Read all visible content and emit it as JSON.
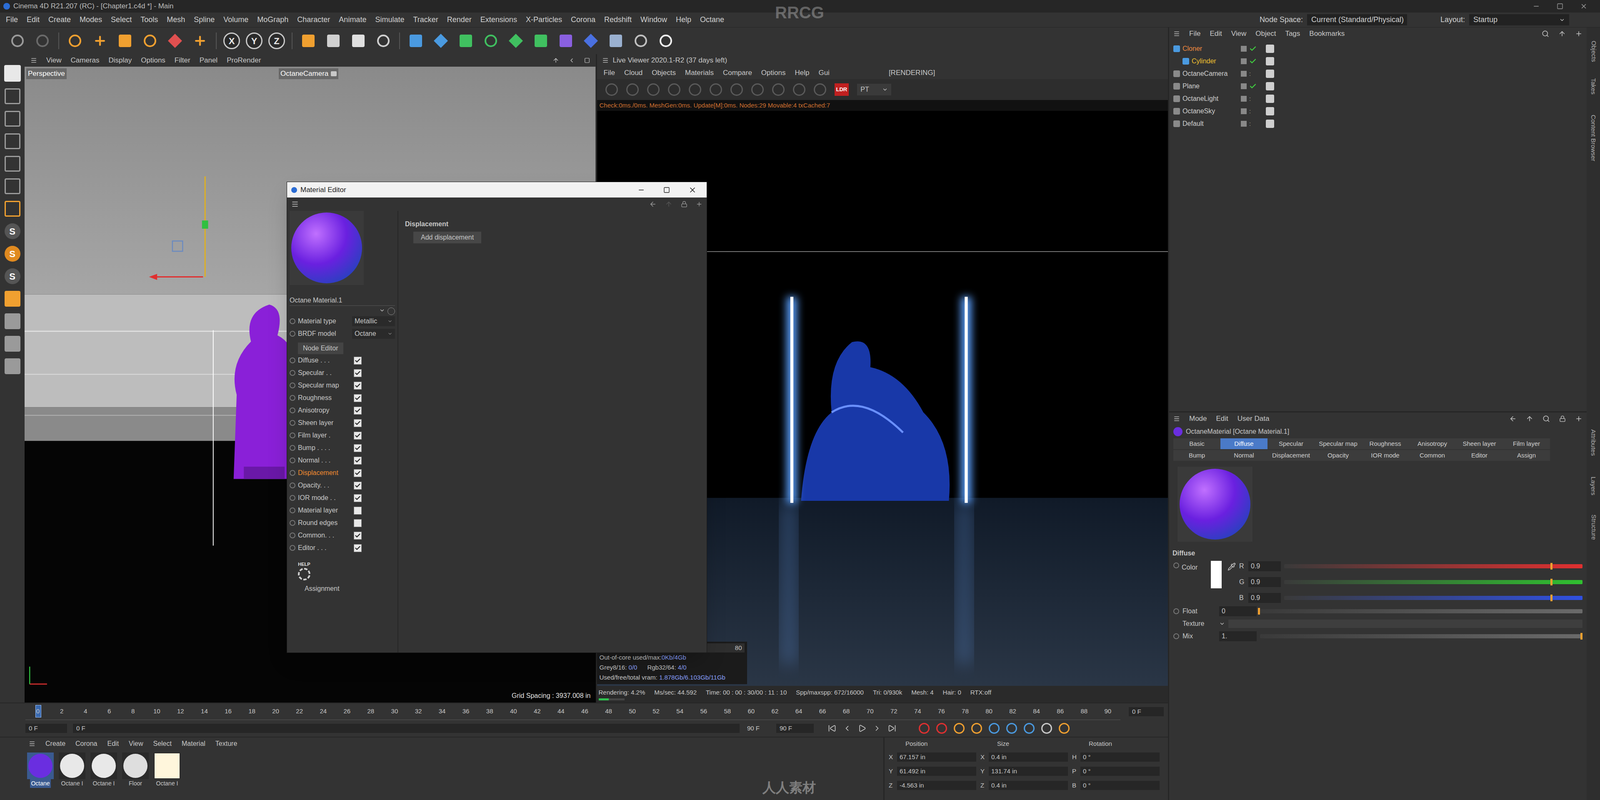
{
  "window": {
    "title": "Cinema 4D R21.207 (RC) - [Chapter1.c4d *] - Main"
  },
  "menu": [
    "File",
    "Edit",
    "Create",
    "Modes",
    "Select",
    "Tools",
    "Mesh",
    "Spline",
    "Volume",
    "MoGraph",
    "Character",
    "Animate",
    "Simulate",
    "Tracker",
    "Render",
    "Extensions",
    "X-Particles",
    "Corona",
    "Redshift",
    "Window",
    "Help",
    "Octane"
  ],
  "node_space": {
    "label": "Node Space:",
    "value": "Current (Standard/Physical)"
  },
  "layout": {
    "label": "Layout:",
    "value": "Startup"
  },
  "toolbar": {
    "axes": [
      "X",
      "Y",
      "Z"
    ]
  },
  "left_tools": {
    "snap_letters": [
      "S",
      "S",
      "S"
    ]
  },
  "viewport": {
    "menu": [
      "View",
      "Cameras",
      "Display",
      "Options",
      "Filter",
      "Panel",
      "ProRender"
    ],
    "name": "Perspective",
    "camera": "OctaneCamera",
    "grid_spacing": "Grid Spacing : 3937.008 in"
  },
  "live_viewer": {
    "title": "Live Viewer 2020.1-R2 (37 days left)",
    "menu": [
      "File",
      "Cloud",
      "Objects",
      "Materials",
      "Compare",
      "Options",
      "Help",
      "Gui"
    ],
    "status": "[RENDERING]",
    "badge": "LDR",
    "mode": "PT",
    "info": "Check:0ms./0ms. MeshGen:0ms. Update[M]:0ms. Nodes:29 Movable:4 txCached:7",
    "field": "80",
    "stats": [
      [
        {
          "label": "Out-of-core used/max:",
          "value": "0Kb/4Gb"
        }
      ],
      [
        {
          "label": "Grey8/16: ",
          "value": "0/0"
        },
        {
          "label": "Rgb32/64: ",
          "value": "4/0"
        }
      ],
      [
        {
          "label": "Used/free/total vram: ",
          "value": "1.878Gb/6.103Gb/11Gb"
        }
      ]
    ],
    "status_bar": [
      "Rendering: 4.2%",
      "Ms/sec: 44.592",
      "Time: 00 : 00 : 30/00 : 11 : 10",
      "Spp/maxspp: 672/16000",
      "Tri: 0/930k",
      "Mesh: 4",
      "Hair: 0",
      "RTX:off"
    ],
    "progress": {
      "level": 0.042
    }
  },
  "material_editor": {
    "title": "Material Editor",
    "material_name": "Octane Material.1",
    "fields": [
      {
        "label": "Material type",
        "value": "Metallic"
      },
      {
        "label": "BRDF model",
        "value": "Octane"
      }
    ],
    "node_button": "Node Editor",
    "channels": [
      {
        "label": "Diffuse . . .",
        "checked": true,
        "selected": false
      },
      {
        "label": "Specular . .",
        "checked": true,
        "selected": false
      },
      {
        "label": "Specular map",
        "checked": true,
        "selected": false
      },
      {
        "label": "Roughness",
        "checked": true,
        "selected": false
      },
      {
        "label": "Anisotropy",
        "checked": true,
        "selected": false
      },
      {
        "label": "Sheen layer",
        "checked": true,
        "selected": false
      },
      {
        "label": "Film layer .",
        "checked": true,
        "selected": false
      },
      {
        "label": "Bump . . . .",
        "checked": true,
        "selected": false
      },
      {
        "label": "Normal . . .",
        "checked": true,
        "selected": false
      },
      {
        "label": "Displacement",
        "checked": true,
        "selected": true
      },
      {
        "label": "Opacity. . .",
        "checked": true,
        "selected": false
      },
      {
        "label": "IOR mode . .",
        "checked": true,
        "selected": false
      },
      {
        "label": "Material layer",
        "checked": false,
        "selected": false
      },
      {
        "label": "Round edges",
        "checked": false,
        "selected": false
      },
      {
        "label": "Common. . .",
        "checked": true,
        "selected": false
      },
      {
        "label": "Editor . . .",
        "checked": true,
        "selected": false
      }
    ],
    "help": "HELP",
    "assignment": "Assignment",
    "section": "Displacement",
    "add_button": "Add displacement"
  },
  "object_manager": {
    "menu": [
      "File",
      "Edit",
      "View",
      "Object",
      "Tags",
      "Bookmarks"
    ],
    "objects": [
      {
        "name": "Cloner",
        "depth": 0,
        "selected": true,
        "enabled": true
      },
      {
        "name": "Cylinder",
        "depth": 1,
        "selected": true,
        "enabled": true
      },
      {
        "name": "OctaneCamera",
        "depth": 0,
        "selected": false,
        "enabled": false
      },
      {
        "name": "Plane",
        "depth": 0,
        "selected": false,
        "enabled": true
      },
      {
        "name": "OctaneLight",
        "depth": 0,
        "selected": false,
        "enabled": false
      },
      {
        "name": "OctaneSky",
        "depth": 0,
        "selected": false,
        "enabled": false
      },
      {
        "name": "Default",
        "depth": 0,
        "selected": false,
        "enabled": false
      }
    ]
  },
  "attributes": {
    "menu": [
      "Mode",
      "Edit",
      "User Data"
    ],
    "title": "OctaneMaterial [Octane Material.1]",
    "tabs": [
      [
        {
          "label": "Basic",
          "selected": false
        },
        {
          "label": "Diffuse",
          "selected": true
        },
        {
          "label": "Specular",
          "selected": false
        },
        {
          "label": "Specular map",
          "selected": false
        },
        {
          "label": "Roughness",
          "selected": false
        },
        {
          "label": "Anisotropy",
          "selected": false
        },
        {
          "label": "Sheen layer",
          "selected": false
        },
        {
          "label": "Film layer",
          "selected": false
        }
      ],
      [
        {
          "label": "Bump",
          "selected": false
        },
        {
          "label": "Normal",
          "selected": false
        },
        {
          "label": "Displacement",
          "selected": false
        },
        {
          "label": "Opacity",
          "selected": false
        },
        {
          "label": "IOR mode",
          "selected": false
        },
        {
          "label": "Common",
          "selected": false
        },
        {
          "label": "Editor",
          "selected": false
        },
        {
          "label": "Assign",
          "selected": false
        }
      ]
    ],
    "section": "Diffuse",
    "color_label": "Color",
    "channels": [
      {
        "name": "R",
        "value": "0.9",
        "level": 0.9,
        "color": "#e03030"
      },
      {
        "name": "G",
        "value": "0.9",
        "level": 0.9,
        "color": "#30c030"
      },
      {
        "name": "B",
        "value": "0.9",
        "level": 0.9,
        "color": "#3050e0"
      }
    ],
    "float": {
      "label": "Float",
      "value": "0",
      "level": 0
    },
    "texture": {
      "label": "Texture"
    },
    "mix": {
      "label": "Mix",
      "value": "1.",
      "level": 1
    }
  },
  "timeline": {
    "ticks": [
      "0",
      "2",
      "4",
      "6",
      "8",
      "10",
      "12",
      "14",
      "16",
      "18",
      "20",
      "22",
      "24",
      "26",
      "28",
      "30",
      "32",
      "34",
      "36",
      "38",
      "40",
      "42",
      "44",
      "46",
      "48",
      "50",
      "52",
      "54",
      "56",
      "58",
      "60",
      "62",
      "64",
      "66",
      "68",
      "70",
      "72",
      "74",
      "76",
      "78",
      "80",
      "82",
      "84",
      "86",
      "88",
      "90"
    ],
    "current": "0 F",
    "start": "0 F",
    "min": "0 F",
    "max": "90 F",
    "end": "90 F"
  },
  "material_manager": {
    "menu": [
      "Create",
      "Corona",
      "Edit",
      "View",
      "Select",
      "Material",
      "Texture"
    ],
    "materials": [
      {
        "name": "Octane",
        "selected": true,
        "color": "#6a2ee0"
      },
      {
        "name": "Octane I",
        "selected": false,
        "color": "#e8e8e8"
      },
      {
        "name": "Octane I",
        "selected": false,
        "color": "#e8e8e8"
      },
      {
        "name": "Floor",
        "selected": false,
        "color": "#dedede"
      },
      {
        "name": "Octane I",
        "selected": false,
        "color": "#fff6dc"
      }
    ]
  },
  "coordinates": {
    "headers": [
      "Position",
      "Size",
      "Rotation"
    ],
    "rows": [
      [
        {
          "axis": "X",
          "value": "67.157 in"
        },
        {
          "axis": "X",
          "value": "0.4 in"
        },
        {
          "axis": "H",
          "value": "0 °"
        }
      ],
      [
        {
          "axis": "Y",
          "value": "61.492 in"
        },
        {
          "axis": "Y",
          "value": "131.74 in"
        },
        {
          "axis": "P",
          "value": "0 °"
        }
      ],
      [
        {
          "axis": "Z",
          "value": "-4.563 in"
        },
        {
          "axis": "Z",
          "value": "0.4 in"
        },
        {
          "axis": "B",
          "value": "0 °"
        }
      ]
    ]
  },
  "side_tabs": {
    "top": [
      "Objects",
      "Takes",
      "Content Browser"
    ],
    "bottom": [
      "Attributes",
      "Layers",
      "Structure"
    ]
  },
  "watermark": {
    "top": "RRCG",
    "bottom": "人人素材"
  }
}
